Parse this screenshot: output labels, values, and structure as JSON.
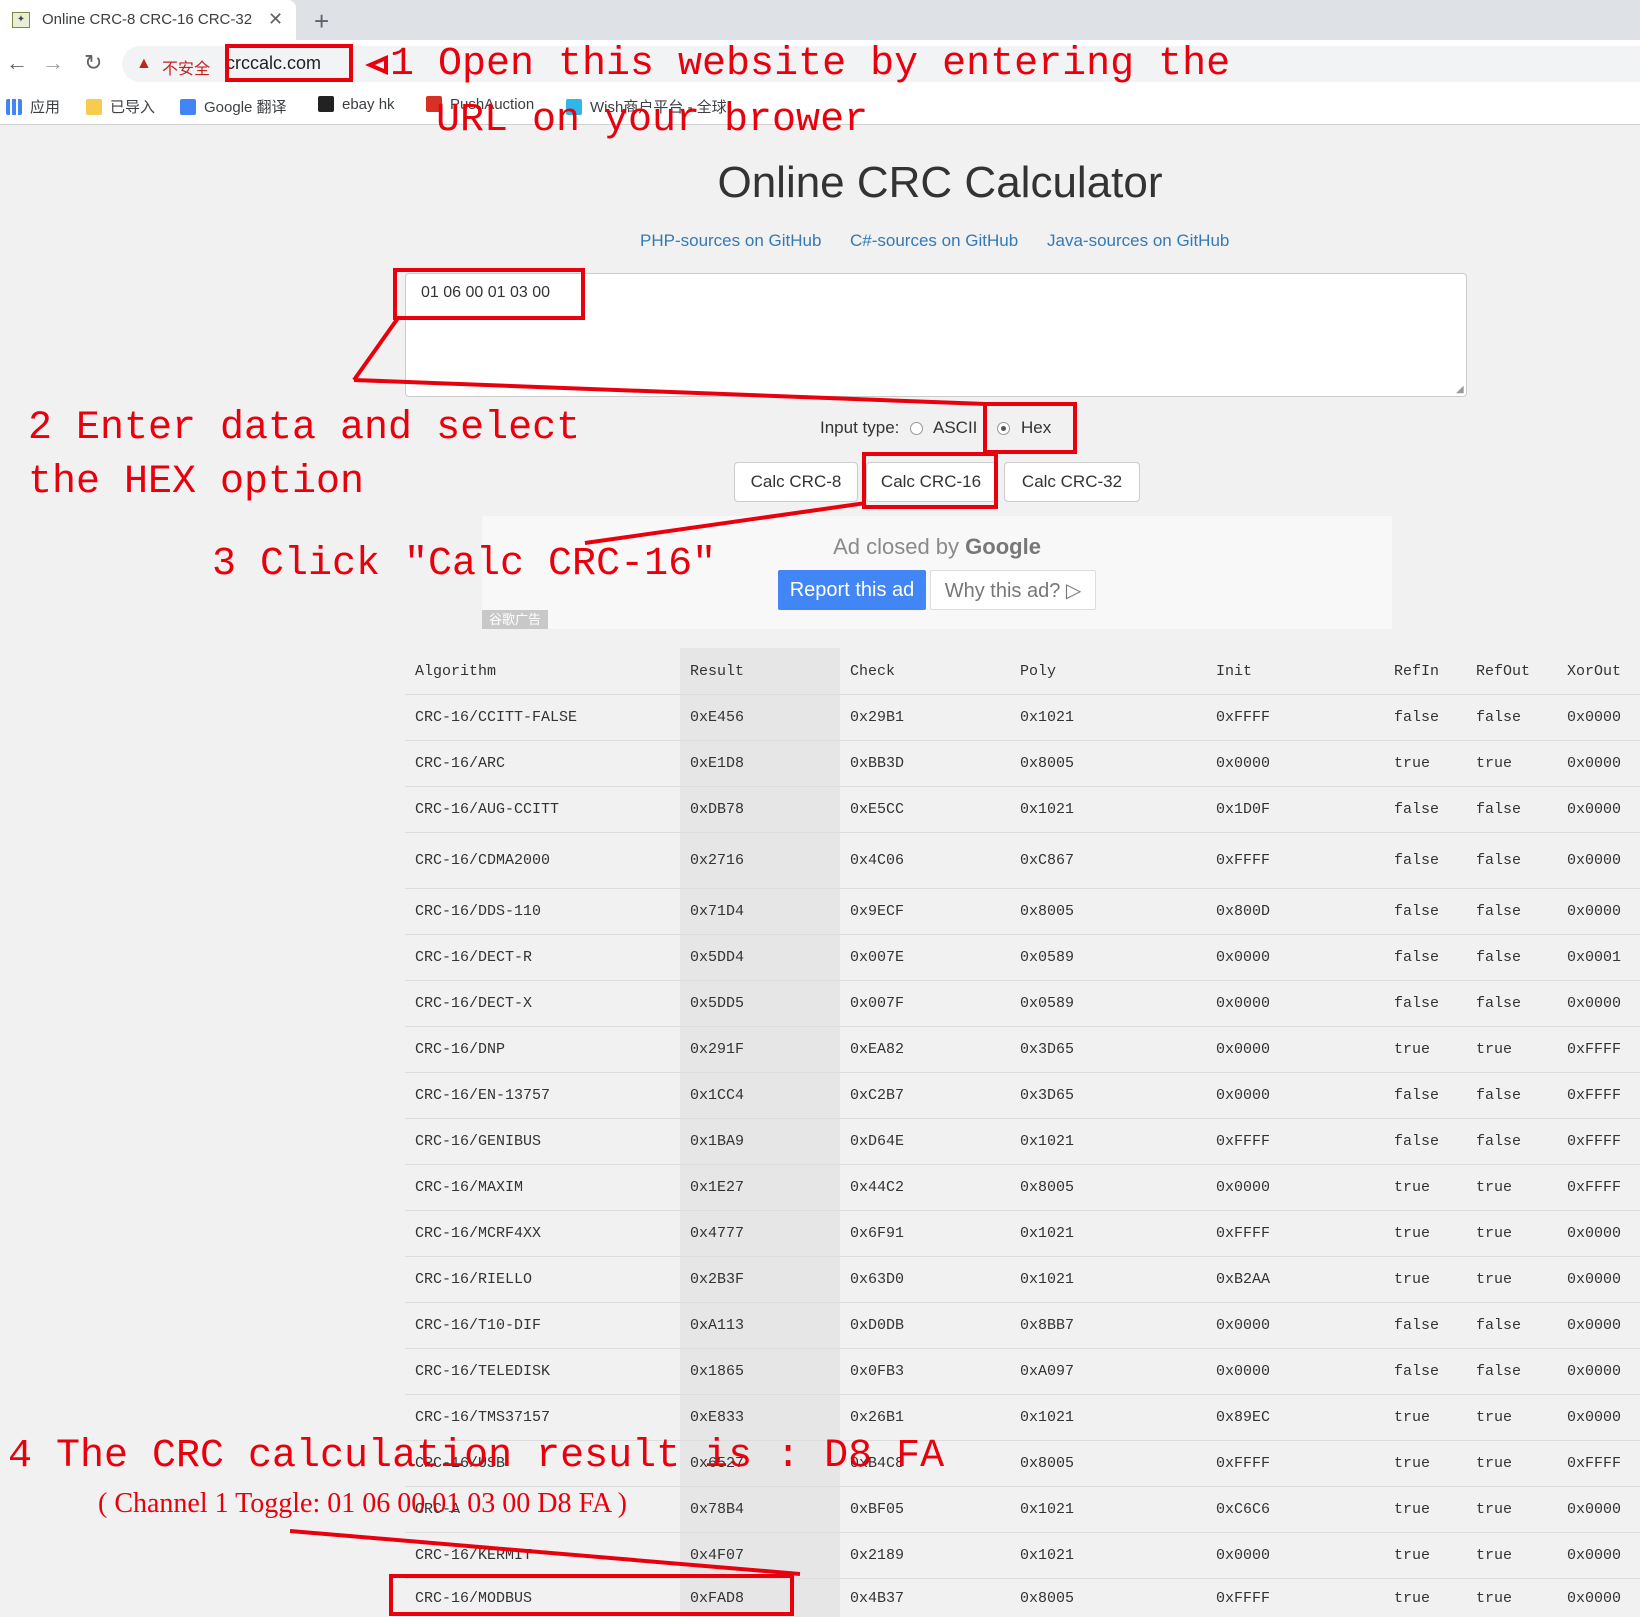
{
  "browser": {
    "tab_title": "Online CRC-8 CRC-16 CRC-32",
    "security_label": "不安全",
    "url": "crccalc.com",
    "bookmarks": [
      {
        "label": "应用",
        "color": "#4285f4"
      },
      {
        "label": "已导入",
        "color": "#f7cb4d"
      },
      {
        "label": "Google 翻译",
        "color": "#4285f4"
      },
      {
        "label": "ebay hk",
        "color": "#222222"
      },
      {
        "label": "PushAuction",
        "color": "#d93025"
      },
      {
        "label": "Wish商户平台 - 全球",
        "color": "#2fb7ec"
      }
    ]
  },
  "page": {
    "title": "Online CRC Calculator",
    "links": [
      "PHP-sources on GitHub",
      "C#-sources on GitHub",
      "Java-sources on GitHub"
    ],
    "input_value": "01 06 00 01 03 00",
    "input_type_label": "Input type:",
    "radio_options": [
      {
        "label": "ASCII",
        "checked": false
      },
      {
        "label": "Hex",
        "checked": true
      }
    ],
    "buttons": [
      "Calc CRC-8",
      "Calc CRC-16",
      "Calc CRC-32"
    ]
  },
  "ad": {
    "closed_text": "Ad closed by",
    "brand": "Google",
    "report_label": "Report this ad",
    "why_label": "Why this ad? ▷",
    "badge": "谷歌广告"
  },
  "table": {
    "headers": [
      "Algorithm",
      "Result",
      "Check",
      "Poly",
      "Init",
      "RefIn",
      "RefOut",
      "XorOut"
    ],
    "rows": [
      [
        "CRC-16/CCITT-FALSE",
        "0xE456",
        "0x29B1",
        "0x1021",
        "0xFFFF",
        "false",
        "false",
        "0x0000"
      ],
      [
        "CRC-16/ARC",
        "0xE1D8",
        "0xBB3D",
        "0x8005",
        "0x0000",
        "true",
        "true",
        "0x0000"
      ],
      [
        "CRC-16/AUG-CCITT",
        "0xDB78",
        "0xE5CC",
        "0x1021",
        "0x1D0F",
        "false",
        "false",
        "0x0000"
      ],
      [
        "CRC-16/CDMA2000",
        "0x2716",
        "0x4C06",
        "0xC867",
        "0xFFFF",
        "false",
        "false",
        "0x0000"
      ],
      [
        "CRC-16/DDS-110",
        "0x71D4",
        "0x9ECF",
        "0x8005",
        "0x800D",
        "false",
        "false",
        "0x0000"
      ],
      [
        "CRC-16/DECT-R",
        "0x5DD4",
        "0x007E",
        "0x0589",
        "0x0000",
        "false",
        "false",
        "0x0001"
      ],
      [
        "CRC-16/DECT-X",
        "0x5DD5",
        "0x007F",
        "0x0589",
        "0x0000",
        "false",
        "false",
        "0x0000"
      ],
      [
        "CRC-16/DNP",
        "0x291F",
        "0xEA82",
        "0x3D65",
        "0x0000",
        "true",
        "true",
        "0xFFFF"
      ],
      [
        "CRC-16/EN-13757",
        "0x1CC4",
        "0xC2B7",
        "0x3D65",
        "0x0000",
        "false",
        "false",
        "0xFFFF"
      ],
      [
        "CRC-16/GENIBUS",
        "0x1BA9",
        "0xD64E",
        "0x1021",
        "0xFFFF",
        "false",
        "false",
        "0xFFFF"
      ],
      [
        "CRC-16/MAXIM",
        "0x1E27",
        "0x44C2",
        "0x8005",
        "0x0000",
        "true",
        "true",
        "0xFFFF"
      ],
      [
        "CRC-16/MCRF4XX",
        "0x4777",
        "0x6F91",
        "0x1021",
        "0xFFFF",
        "true",
        "true",
        "0x0000"
      ],
      [
        "CRC-16/RIELLO",
        "0x2B3F",
        "0x63D0",
        "0x1021",
        "0xB2AA",
        "true",
        "true",
        "0x0000"
      ],
      [
        "CRC-16/T10-DIF",
        "0xA113",
        "0xD0DB",
        "0x8BB7",
        "0x0000",
        "false",
        "false",
        "0x0000"
      ],
      [
        "CRC-16/TELEDISK",
        "0x1865",
        "0x0FB3",
        "0xA097",
        "0x0000",
        "false",
        "false",
        "0x0000"
      ],
      [
        "CRC-16/TMS37157",
        "0xE833",
        "0x26B1",
        "0x1021",
        "0x89EC",
        "true",
        "true",
        "0x0000"
      ],
      [
        "CRC-16/USB",
        "0x6527",
        "0xB4C8",
        "0x8005",
        "0xFFFF",
        "true",
        "true",
        "0xFFFF"
      ],
      [
        "CRC-A",
        "0x78B4",
        "0xBF05",
        "0x1021",
        "0xC6C6",
        "true",
        "true",
        "0x0000"
      ],
      [
        "CRC-16/KERMIT",
        "0x4F07",
        "0x2189",
        "0x1021",
        "0x0000",
        "true",
        "true",
        "0x0000"
      ],
      [
        "CRC-16/MODBUS",
        "0xFAD8",
        "0x4B37",
        "0x8005",
        "0xFFFF",
        "true",
        "true",
        "0x0000"
      ]
    ]
  },
  "annotations": {
    "step1_line1": "1 Open this website by entering the",
    "step1_line2": "URL on your brower",
    "step2_line1": "2 Enter data and select",
    "step2_line2": "the HEX option",
    "step3": "3 Click \"Calc CRC-16\"",
    "step4": "4 The CRC calculation result is : D8 FA",
    "step4_sub": "( Channel 1 Toggle:  01 06 00 01 03 00 D8 FA )"
  },
  "colors": {
    "annotation_red": "#e8000d",
    "link_blue": "#337ab7",
    "ad_button_blue": "#4285f4"
  }
}
